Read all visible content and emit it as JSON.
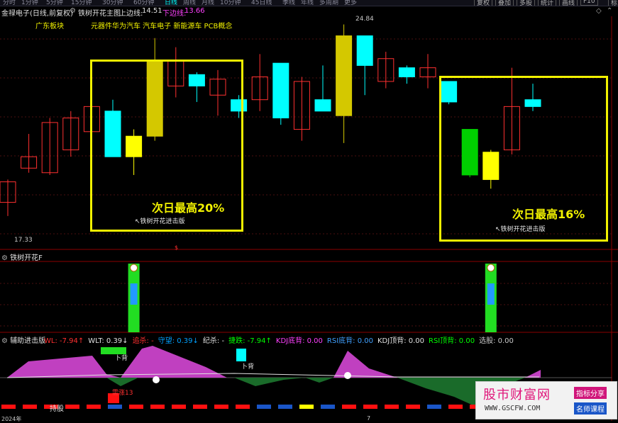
{
  "top_menu": {
    "items": [
      "分时",
      "1分钟",
      "5分钟",
      "15分钟",
      "30分钟",
      "60分钟",
      "日线",
      "周线",
      "月线",
      "10分钟",
      "45日线",
      "季线",
      "年线",
      "多周期",
      "更多"
    ],
    "active": "日线",
    "right_buttons": [
      "复权",
      "叠加",
      "多股",
      "统计",
      "画线",
      "F10",
      "标记"
    ]
  },
  "header": {
    "stock": "金禄电子(日线,前复权)",
    "indicator": "铁树开花主图",
    "upper_label": "上边线:",
    "upper_value": "14.51",
    "lower_label": "下边线:",
    "lower_value": "13.66"
  },
  "concepts": {
    "region": "广东板块",
    "tags": "元器件华为汽车 汽车电子 新能源车 PCB概念"
  },
  "main_chart": {
    "high_label": "24.84",
    "low_label": "17.33",
    "box1_text": "次日最高20%",
    "box1_note": "↖铁树开花进击版",
    "box2_text": "次日最高16%",
    "box2_note": "↖铁树开花进击版",
    "candles": [
      {
        "o": 18.0,
        "c": 18.9,
        "h": 19.0,
        "l": 17.4,
        "color": "red"
      },
      {
        "o": 19.5,
        "c": 20.0,
        "h": 21.0,
        "l": 19.3,
        "color": "red"
      },
      {
        "o": 19.3,
        "c": 21.5,
        "h": 21.7,
        "l": 19.2,
        "color": "red"
      },
      {
        "o": 20.3,
        "c": 21.7,
        "h": 22.0,
        "l": 20.0,
        "color": "red"
      },
      {
        "o": 22.2,
        "c": 21.1,
        "h": 22.3,
        "l": 20.8,
        "color": "red"
      },
      {
        "o": 22.0,
        "c": 20.0,
        "h": 22.5,
        "l": 20.0,
        "color": "cyan"
      },
      {
        "o": 20.9,
        "c": 20.0,
        "h": 21.2,
        "l": 19.2,
        "color": "yellow"
      },
      {
        "o": 24.2,
        "c": 20.9,
        "h": 25.2,
        "l": 20.7,
        "color": "gold"
      },
      {
        "o": 24.2,
        "c": 23.1,
        "h": 24.8,
        "l": 22.6,
        "color": "red"
      },
      {
        "o": 23.6,
        "c": 23.1,
        "h": 23.7,
        "l": 22.4,
        "color": "cyan"
      },
      {
        "o": 22.7,
        "c": 23.4,
        "h": 23.8,
        "l": 21.8,
        "color": "red"
      },
      {
        "o": 22.5,
        "c": 22.0,
        "h": 22.7,
        "l": 21.7,
        "color": "cyan"
      },
      {
        "o": 22.5,
        "c": 23.5,
        "h": 24.5,
        "l": 22.0,
        "color": "red"
      },
      {
        "o": 24.1,
        "c": 21.7,
        "h": 24.1,
        "l": 21.4,
        "color": "cyan"
      },
      {
        "o": 23.3,
        "c": 21.2,
        "h": 23.5,
        "l": 20.7,
        "color": "red"
      },
      {
        "o": 22.5,
        "c": 22.0,
        "h": 24.0,
        "l": 22.0,
        "color": "cyan"
      },
      {
        "o": 25.3,
        "c": 21.8,
        "h": 25.8,
        "l": 20.6,
        "color": "gold"
      },
      {
        "o": 25.3,
        "c": 24.0,
        "h": 25.3,
        "l": 22.7,
        "color": "cyan"
      },
      {
        "o": 23.3,
        "c": 24.3,
        "h": 24.6,
        "l": 23.0,
        "color": "red"
      },
      {
        "o": 23.9,
        "c": 23.5,
        "h": 24.0,
        "l": 23.2,
        "color": "cyan"
      },
      {
        "o": 23.5,
        "c": 23.9,
        "h": 24.5,
        "l": 23.0,
        "color": "red"
      },
      {
        "o": 23.3,
        "c": 22.4,
        "h": 23.3,
        "l": 22.3,
        "color": "cyan"
      },
      {
        "o": 21.2,
        "c": 19.2,
        "h": 21.2,
        "l": 19.1,
        "color": "green"
      },
      {
        "o": 20.2,
        "c": 19.0,
        "h": 20.3,
        "l": 18.6,
        "color": "yellow"
      },
      {
        "o": 20.3,
        "c": 22.2,
        "h": 23.9,
        "l": 20.1,
        "color": "red"
      },
      {
        "o": 22.5,
        "c": 22.2,
        "h": 23.2,
        "l": 22.0,
        "color": "cyan"
      }
    ]
  },
  "panel2": {
    "title": "铁树开花F",
    "markers": [
      {
        "index": 6,
        "label": "$"
      },
      {
        "index": 23,
        "label": "$"
      }
    ]
  },
  "panel3": {
    "title": "辅助进击版",
    "indicators": [
      {
        "text": "WL: -7.94↑",
        "color": "#ff3030"
      },
      {
        "text": "WLT: 0.39↓",
        "color": "#e0e0e0"
      },
      {
        "text": "追杀: -",
        "color": "#ff3030"
      },
      {
        "text": "守望: 0.39↓",
        "color": "#00a0ff"
      },
      {
        "text": "纪杀: -",
        "color": "#e0e0e0"
      },
      {
        "text": "捷跌: -7.94↑",
        "color": "#00ff00"
      },
      {
        "text": "KDJ底背: 0.00",
        "color": "#ff40ff"
      },
      {
        "text": "RSI底背: 0.00",
        "color": "#40a0ff"
      },
      {
        "text": "KDJ顶背: 0.00",
        "color": "#e0e0e0"
      },
      {
        "text": "RSI顶背: 0.00",
        "color": "#00ff00"
      },
      {
        "text": "选股: 0.00",
        "color": "#c8c8c8"
      }
    ],
    "label_buy1": "卜背",
    "label_buy2": "卜背",
    "label_red": "需涨13",
    "label_hold": "持股",
    "date_left": "2024年",
    "date_mid": "7"
  },
  "watermark": {
    "logo": "股市财富网",
    "url": "WWW.GSCFW.COM",
    "tag1": "指标分享",
    "tag2": "名师课程"
  },
  "colors": {
    "up": "#ff3030",
    "cyan": "#00ffff",
    "gold": "#d4c800",
    "yellow": "#ffff00",
    "green": "#00d000",
    "box": "#f2f200",
    "magenta": "#c040c0"
  }
}
